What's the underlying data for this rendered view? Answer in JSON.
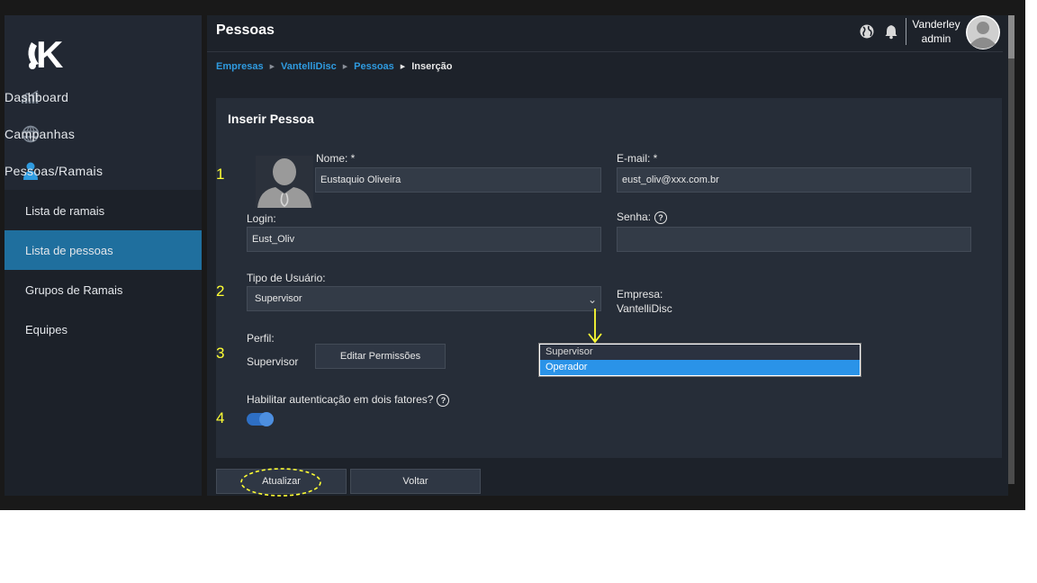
{
  "sidebar": {
    "logo_text": "K",
    "nav": [
      {
        "label": "Dashboard",
        "icon": "chart-icon"
      },
      {
        "label": "Campanhas",
        "icon": "globe-icon"
      },
      {
        "label": "Pessoas/Ramais",
        "icon": "person-icon"
      }
    ],
    "sub": [
      {
        "label": "Lista de ramais",
        "active": false
      },
      {
        "label": "Lista de pessoas",
        "active": true
      },
      {
        "label": "Grupos de Ramais",
        "active": false
      },
      {
        "label": "Equipes",
        "active": false
      }
    ]
  },
  "header": {
    "title": "Pessoas",
    "user": {
      "name": "Vanderley",
      "role": "admin"
    }
  },
  "breadcrumb": [
    {
      "label": "Empresas"
    },
    {
      "label": "VantelliDisc"
    },
    {
      "label": "Pessoas"
    },
    {
      "label": "Inserção"
    }
  ],
  "form": {
    "title": "Inserir Pessoa",
    "nome": {
      "label": "Nome: *",
      "value": "Eustaquio Oliveira"
    },
    "email": {
      "label": "E-mail: *",
      "value": "eust_oliv@xxx.com.br"
    },
    "login": {
      "label": "Login:",
      "value": "Eust_Oliv"
    },
    "senha": {
      "label": "Senha:",
      "value": ""
    },
    "tipo": {
      "label": "Tipo de Usuário:",
      "value": "Supervisor",
      "options": [
        "Supervisor",
        "Operador"
      ]
    },
    "empresa": {
      "label": "Empresa:",
      "value": "VantelliDisc"
    },
    "perfil": {
      "label": "Perfil:",
      "value": "Supervisor",
      "button": "Editar Permissões"
    },
    "dois_fatores": {
      "label": "Habilitar autenticação em dois fatores?",
      "enabled": true
    },
    "help_glyph": "?"
  },
  "actions": {
    "update": "Atualizar",
    "back": "Voltar"
  },
  "annotations": [
    "1",
    "2",
    "3",
    "4"
  ],
  "colors": {
    "accent": "#1f6f9e",
    "link": "#2f9be0",
    "annotation": "#ffff33",
    "toggle": "#2e6fc4"
  }
}
